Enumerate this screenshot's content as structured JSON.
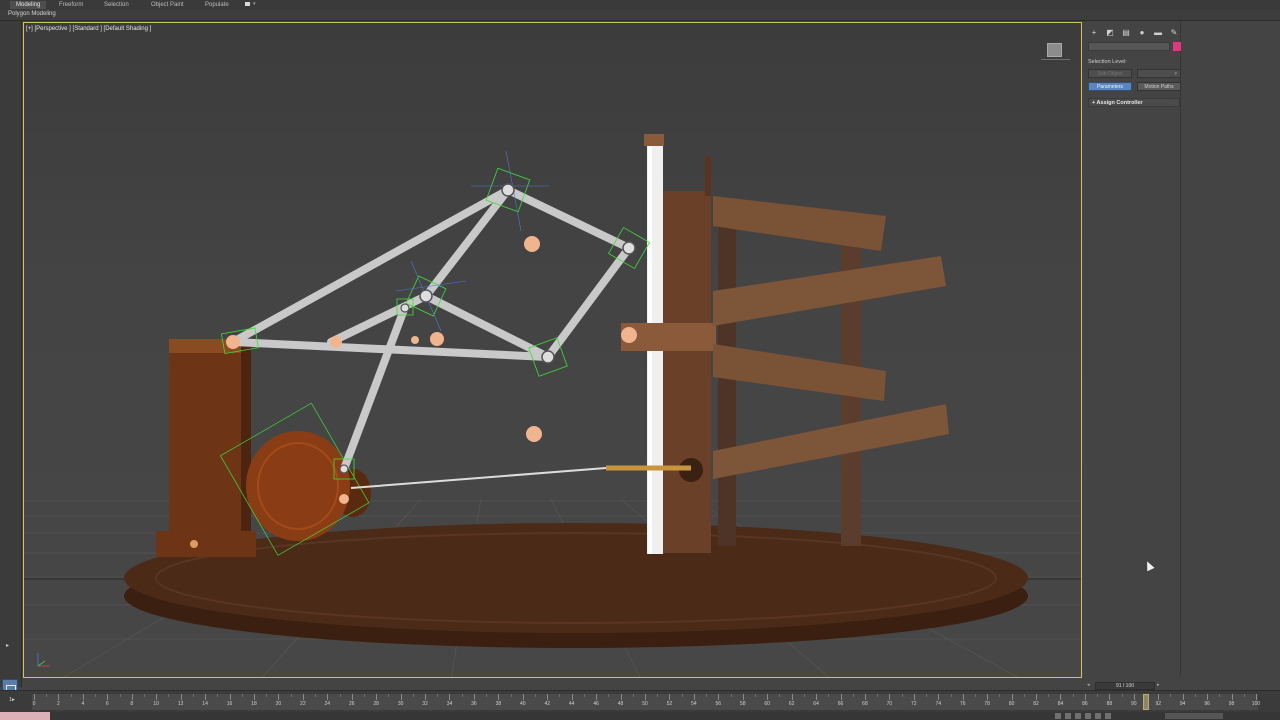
{
  "ribbon": {
    "tabs": [
      "Modeling",
      "Freeform",
      "Selection",
      "Object Paint",
      "Populate"
    ],
    "active_tab": "Modeling",
    "panel_label": "Polygon Modeling"
  },
  "viewport": {
    "label": "[+] [Perspective ] [Standard ] [Default Shading ]"
  },
  "command_panel": {
    "tab_icons": [
      "create-icon",
      "modify-icon",
      "hierarchy-icon",
      "motion-icon",
      "display-icon",
      "utilities-icon"
    ],
    "object_color": "#e2367e",
    "selection_level_label": "Selection Level:",
    "sub_object_label": "Sub-Object",
    "parameters_label": "Parameters",
    "motion_paths_label": "Motion Paths",
    "assign_controller_label": "Assign Controller"
  },
  "timeline": {
    "frame_display": "91 / 100",
    "current_frame": 91,
    "total_frames": 100,
    "tick_labels": [
      "0",
      "2",
      "4",
      "6",
      "8",
      "10",
      "12",
      "14",
      "16",
      "18",
      "20",
      "22",
      "24",
      "26",
      "28",
      "30",
      "32",
      "34",
      "36",
      "38",
      "40",
      "42",
      "44",
      "46",
      "48",
      "50",
      "52",
      "54",
      "56",
      "58",
      "60",
      "62",
      "64",
      "66",
      "68",
      "70",
      "72",
      "74",
      "76",
      "78",
      "80",
      "82",
      "84",
      "86",
      "88",
      "90",
      "92",
      "94",
      "96",
      "98",
      "100"
    ]
  },
  "colors": {
    "accent": "#5b86bd",
    "viewport_border": "#c9c65c",
    "selection_wire": "#3fdc3a",
    "wood_light": "#8a4a22",
    "wood_dark": "#4a2a16",
    "link_gray": "#c9c9c9",
    "joint_peach": "#f0b48e"
  }
}
